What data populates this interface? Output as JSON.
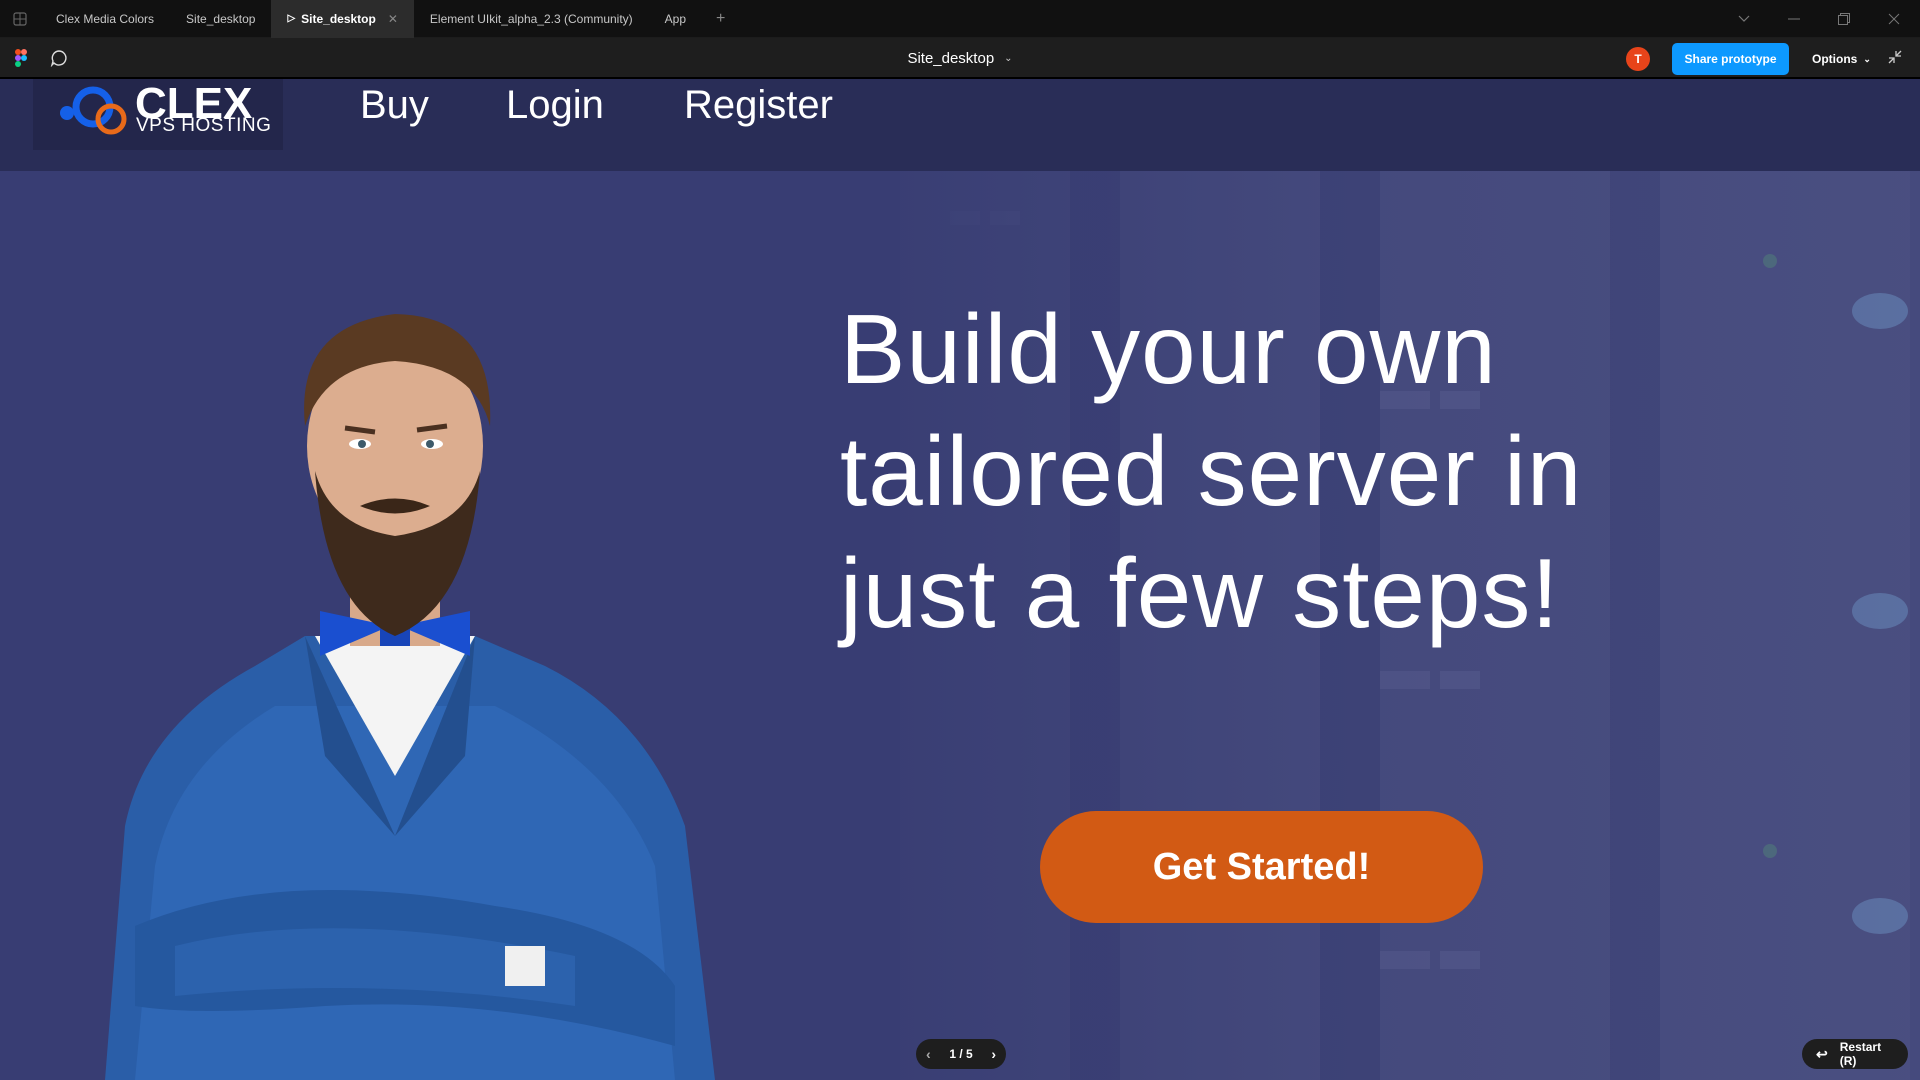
{
  "titlebar": {
    "tabs": [
      {
        "label": "Clex Media Colors"
      },
      {
        "label": "Site_desktop"
      },
      {
        "label": "Site_desktop",
        "active": true
      },
      {
        "label": "Element UIkit_alpha_2.3 (Community)"
      },
      {
        "label": "App"
      }
    ],
    "plus_label": "+"
  },
  "toolbar": {
    "file_title": "Site_desktop",
    "avatar_initial": "T",
    "share_label": "Share prototype",
    "options_label": "Options"
  },
  "site": {
    "logo": {
      "brand": "CLEX",
      "tagline": "VPS HOSTING"
    },
    "nav": {
      "buy": "Buy",
      "login": "Login",
      "register": "Register"
    },
    "hero": {
      "headline_line1": "Build your own",
      "headline_line2": "tailored server in",
      "headline_line3": "just a few steps!",
      "cta_label": "Get Started!"
    }
  },
  "prototype": {
    "pager": "1 / 5",
    "restart_label": "Restart (R)"
  },
  "colors": {
    "nav_bg": "#292d57",
    "hero_bg": "#383d73",
    "cta": "#d25a14",
    "share": "#0d99ff",
    "avatar": "#e8441a"
  }
}
